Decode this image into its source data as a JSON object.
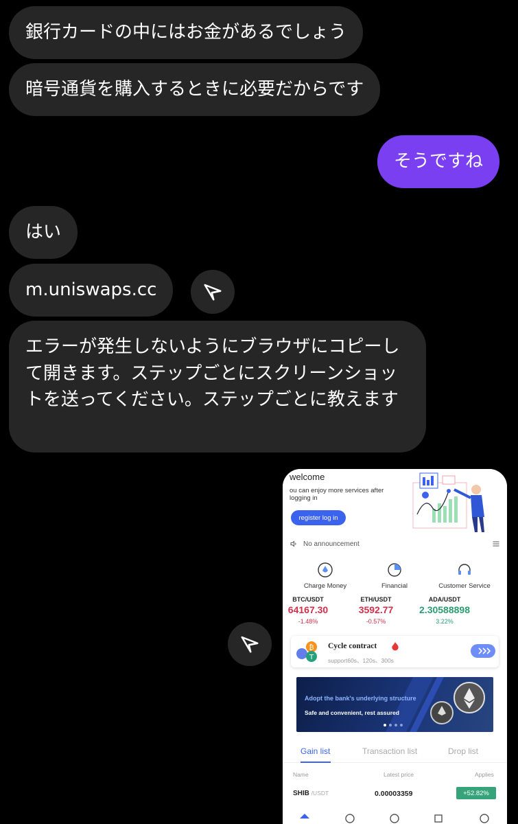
{
  "messages": [
    {
      "text": "銀行カードの中にはお金があるでしょう",
      "direction": "in"
    },
    {
      "text": "暗号通貨を購入するときに必要だからです",
      "direction": "in"
    },
    {
      "text": "そうですね",
      "direction": "out"
    },
    {
      "text": "はい",
      "direction": "in"
    },
    {
      "text": "m.uniswaps.cc",
      "direction": "in"
    },
    {
      "text": "エラーが発生しないようにブラウザにコピーして開きます。ステップごとにスクリーンショットを送ってください。ステップごとに教えます",
      "direction": "in"
    }
  ],
  "icons": {
    "share": "paper-plane-icon"
  },
  "colors": {
    "background": "#000000",
    "incoming_bubble": "#262626",
    "outgoing_bubble": "#7a3ff0"
  },
  "shared_screenshot": {
    "hero": {
      "title": "welcome",
      "subtitle": "ou can enjoy more services after logging in",
      "button": "register log in"
    },
    "announcement": "No announcement",
    "services": [
      "Charge Money",
      "Financial",
      "Customer Service"
    ],
    "tickers": [
      {
        "pair": "BTC/USDT",
        "price": "64167.30",
        "change": "-1.48%",
        "trend": "down"
      },
      {
        "pair": "ETH/USDT",
        "price": "3592.77",
        "change": "-0.57%",
        "trend": "down"
      },
      {
        "pair": "ADA/USDT",
        "price": "2.30588898",
        "change": "3.22%",
        "trend": "up"
      }
    ],
    "cycle": {
      "title": "Cycle contract",
      "subtitle": "support60s、120s、300s"
    },
    "banner": {
      "line1": "Adopt the bank's underlying structure",
      "line2": "Safe and convenient, rest assured"
    },
    "tabs": [
      "Gain list",
      "Transaction list",
      "Drop list"
    ],
    "table_headers": [
      "Name",
      "Latest price",
      "Applies"
    ],
    "rows": [
      {
        "symbol": "SHIB",
        "quote": "/USDT",
        "price": "0.00003359",
        "change": "+52.82%"
      }
    ]
  }
}
